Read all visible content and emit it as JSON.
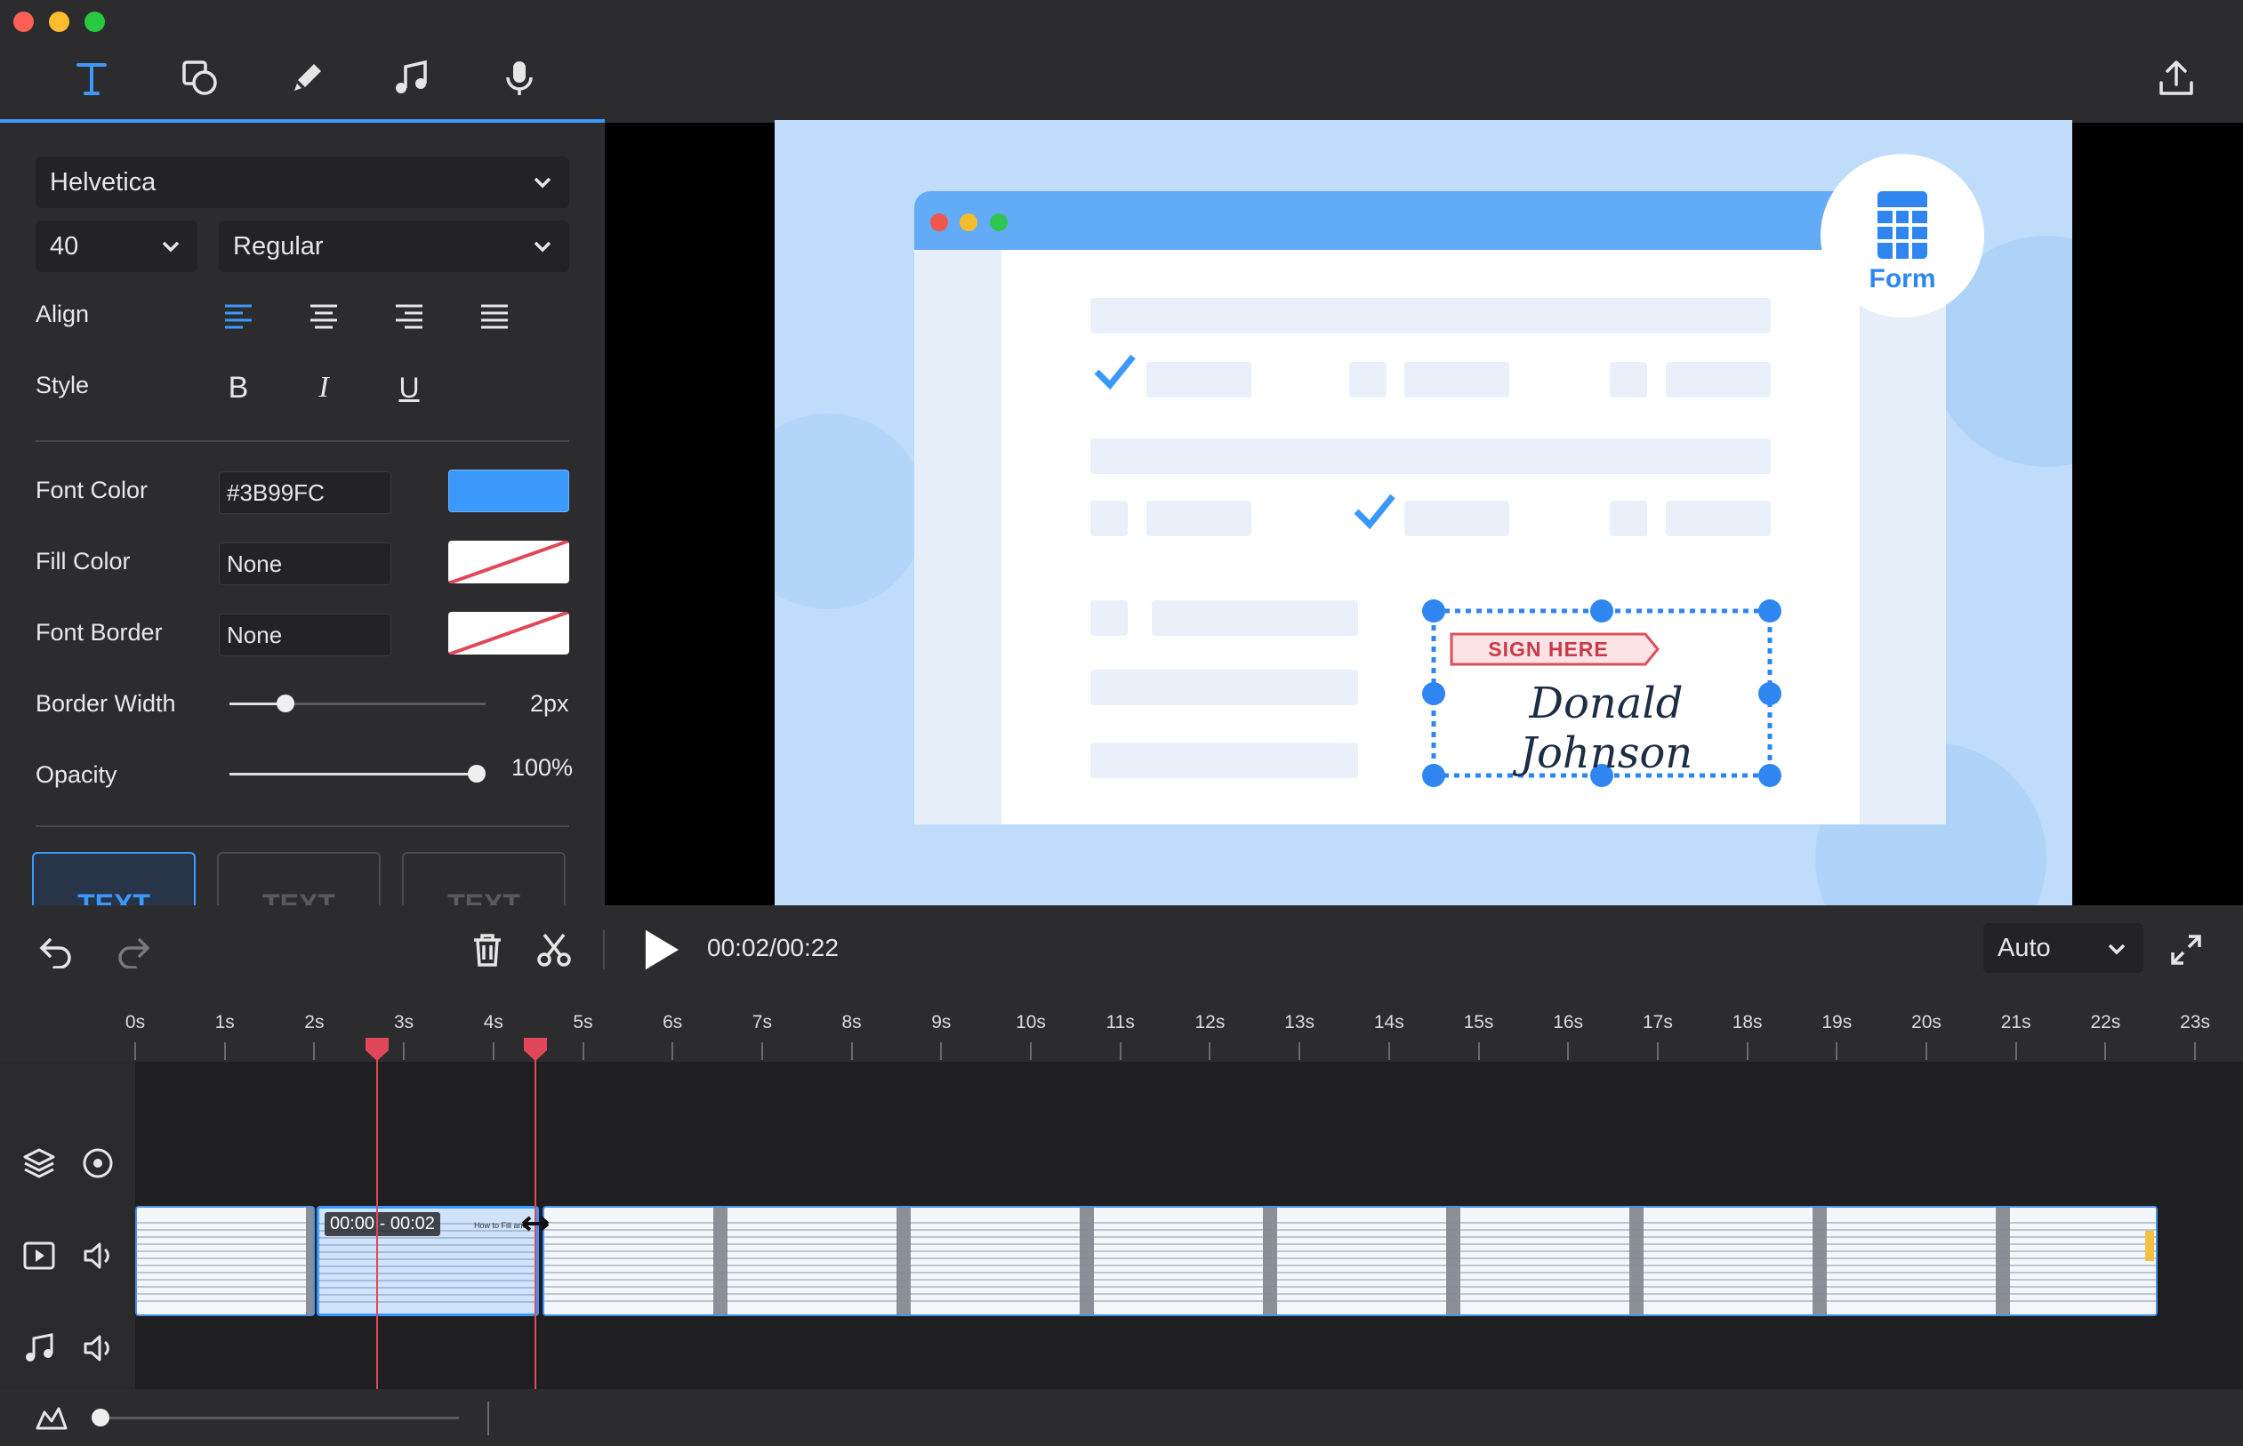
{
  "toolbar": {
    "tools": [
      "text-icon",
      "shape-icon",
      "pen-icon",
      "music-note-icon",
      "microphone-icon"
    ],
    "export": "export-icon"
  },
  "text_panel": {
    "font_family": "Helvetica",
    "font_size": "40",
    "font_weight": "Regular",
    "align_label": "Align",
    "style_label": "Style",
    "style_buttons": [
      "B",
      "I",
      "U"
    ],
    "font_color_label": "Font Color",
    "font_color_value": "#3B99FC",
    "fill_color_label": "Fill Color",
    "fill_color_value": "None",
    "font_border_label": "Font Border",
    "font_border_value": "None",
    "border_width_label": "Border Width",
    "border_width_value": "2px",
    "border_width_fraction": 0.22,
    "opacity_label": "Opacity",
    "opacity_value": "100%",
    "opacity_fraction": 1.0,
    "presets": [
      "TEXT",
      "TEXT",
      "TEXT"
    ]
  },
  "colors": {
    "accent": "#3B99FC",
    "playhead": "#e0485a"
  },
  "preview": {
    "badge_label": "Form",
    "sign_here": "SIGN HERE",
    "signature": "Donald Johnson"
  },
  "controls": {
    "timecode": "00:02/00:22",
    "zoom_mode": "Auto"
  },
  "timeline": {
    "ticks": [
      "0s",
      "1s",
      "2s",
      "3s",
      "4s",
      "5s",
      "6s",
      "7s",
      "8s",
      "9s",
      "10s",
      "11s",
      "12s",
      "13s",
      "14s",
      "15s",
      "16s",
      "17s",
      "18s",
      "19s",
      "20s",
      "21s",
      "22s",
      "23s"
    ],
    "selected_clip_label": "00:00 - 00:02",
    "selected_clip_caption": "How to Fill and"
  }
}
